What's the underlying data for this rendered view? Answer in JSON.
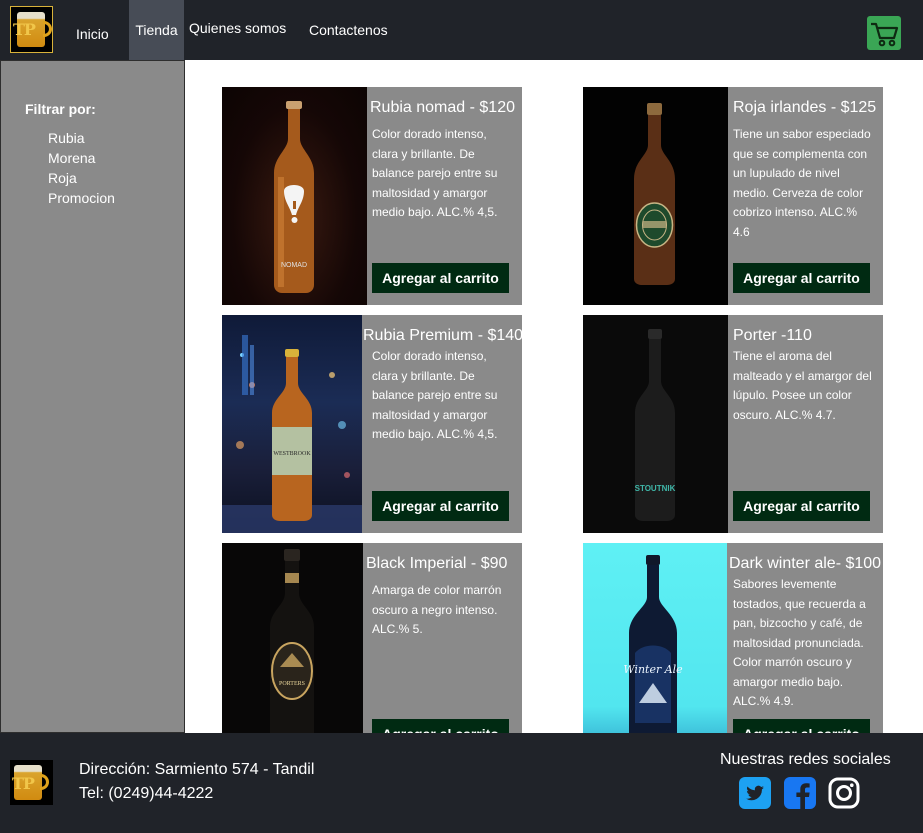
{
  "header": {
    "logo_text": "TP",
    "nav": [
      "Inicio",
      "Tienda",
      "Quienes somos",
      "Contactenos"
    ],
    "cart_icon": "shopping-cart-icon"
  },
  "sidebar": {
    "title": "Filtrar por:",
    "filters": [
      "Rubia",
      "Morena",
      "Roja",
      "Promocion"
    ]
  },
  "products": [
    {
      "title": "Rubia nomad - $120",
      "desc": "Color dorado intenso, clara y brillante. De balance parejo entre su maltosidad y amargor medio bajo. ALC.% 4,5.",
      "button": "Agregar al carrito",
      "label": "NOMAD"
    },
    {
      "title": "Roja irlandes - $125",
      "desc": "Tiene un sabor especiado que se complementa con un lupulado de nivel medio. Cerveza de color cobrizo intenso. ALC.% 4.6",
      "button": "Agregar al carrito"
    },
    {
      "title": "Rubia Premium - $140",
      "desc": "Color dorado intenso, clara y brillante. De balance parejo entre su maltosidad y amargor medio bajo. ALC.% 4,5.",
      "button": "Agregar al carrito",
      "label": "WESTBROOK"
    },
    {
      "title": "Porter -110",
      "desc": "Tiene el aroma del malteado y el amargor del lúpulo. Posee un color oscuro. ALC.% 4.7.",
      "button": "Agregar al carrito",
      "label": "STOUTNIK"
    },
    {
      "title": "Black Imperial - $90",
      "desc": "Amarga de color marrón oscuro a negro intenso. ALC.% 5.",
      "button": "Agregar al carrito",
      "label": "PORTERS"
    },
    {
      "title": "Dark winter ale- $100",
      "desc": "Sabores levemente tostados, que recuerda a pan, bizcocho y café, de maltosidad pronunciada. Color marrón oscuro y amargor medio bajo. ALC.% 4.9.",
      "button": "Agregar al carrito",
      "label": "Winter Ale"
    }
  ],
  "footer": {
    "logo_text": "TP",
    "address": "Dirección: Sarmiento 574 - Tandil",
    "phone": "Tel: (0249)44-4222",
    "social_title": "Nuestras redes sociales",
    "social_icons": [
      "twitter-icon",
      "facebook-icon",
      "instagram-icon"
    ]
  }
}
